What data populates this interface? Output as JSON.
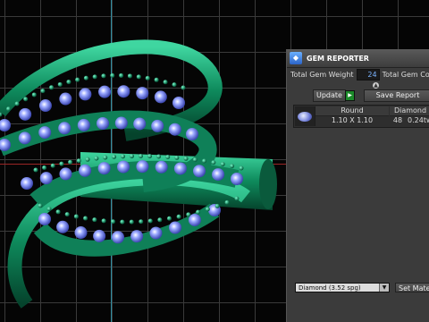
{
  "viewport": {
    "name": "3D viewport"
  },
  "panel": {
    "title": "GEM REPORTER",
    "icon": "gem-reporter-icon",
    "total_weight_label": "Total Gem Weight",
    "total_weight_value": "24",
    "total_count_label": "Total Gem Co",
    "update_label": "Update",
    "save_report_label": "Save Report",
    "table": {
      "columns": [
        "Round",
        "Diamond"
      ],
      "rows": [
        {
          "icon": "round-gem-icon",
          "size": "1.10 X 1.10",
          "count": "48",
          "weight": "0.24tw"
        }
      ]
    },
    "material_select": {
      "value": "Diamond    (3.52 spg)"
    },
    "set_material_label": "Set Mater"
  }
}
